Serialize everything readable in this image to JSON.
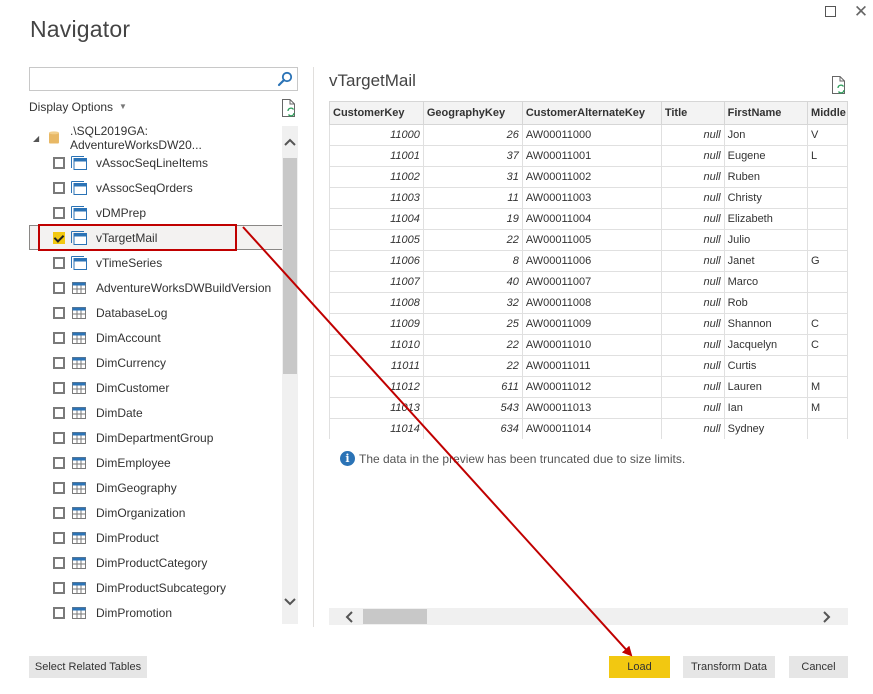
{
  "window": {
    "title": "Navigator",
    "maximize_icon": "maximize-icon",
    "close_icon": "close-icon",
    "close_glyph": "✕"
  },
  "left_panel": {
    "search": {
      "value": "",
      "placeholder": "",
      "icon": "search-icon"
    },
    "display_options": {
      "label": "Display Options",
      "caret": "▼"
    },
    "refresh_icon": "refresh-document-icon",
    "tree": {
      "root": {
        "label": ".\\SQL2019GA: AdventureWorksDW20...",
        "icon": "database-icon",
        "expander": "◢"
      },
      "items": [
        {
          "label": "vAssocSeqLineItems",
          "type": "view",
          "checked": false
        },
        {
          "label": "vAssocSeqOrders",
          "type": "view",
          "checked": false
        },
        {
          "label": "vDMPrep",
          "type": "view",
          "checked": false
        },
        {
          "label": "vTargetMail",
          "type": "view",
          "checked": true
        },
        {
          "label": "vTimeSeries",
          "type": "view",
          "checked": false
        },
        {
          "label": "AdventureWorksDWBuildVersion",
          "type": "table",
          "checked": false
        },
        {
          "label": "DatabaseLog",
          "type": "table",
          "checked": false
        },
        {
          "label": "DimAccount",
          "type": "table",
          "checked": false
        },
        {
          "label": "DimCurrency",
          "type": "table",
          "checked": false
        },
        {
          "label": "DimCustomer",
          "type": "table",
          "checked": false
        },
        {
          "label": "DimDate",
          "type": "table",
          "checked": false
        },
        {
          "label": "DimDepartmentGroup",
          "type": "table",
          "checked": false
        },
        {
          "label": "DimEmployee",
          "type": "table",
          "checked": false
        },
        {
          "label": "DimGeography",
          "type": "table",
          "checked": false
        },
        {
          "label": "DimOrganization",
          "type": "table",
          "checked": false
        },
        {
          "label": "DimProduct",
          "type": "table",
          "checked": false
        },
        {
          "label": "DimProductCategory",
          "type": "table",
          "checked": false
        },
        {
          "label": "DimProductSubcategory",
          "type": "table",
          "checked": false
        },
        {
          "label": "DimPromotion",
          "type": "table",
          "checked": false
        }
      ]
    },
    "scroll_up": "⌃",
    "scroll_down": "⌄"
  },
  "preview": {
    "title": "vTargetMail",
    "columns": [
      "CustomerKey",
      "GeographyKey",
      "CustomerAlternateKey",
      "Title",
      "FirstName",
      "Middle"
    ],
    "rows": [
      [
        "11000",
        "26",
        "AW00011000",
        "null",
        "Jon",
        "V"
      ],
      [
        "11001",
        "37",
        "AW00011001",
        "null",
        "Eugene",
        "L"
      ],
      [
        "11002",
        "31",
        "AW00011002",
        "null",
        "Ruben",
        ""
      ],
      [
        "11003",
        "11",
        "AW00011003",
        "null",
        "Christy",
        ""
      ],
      [
        "11004",
        "19",
        "AW00011004",
        "null",
        "Elizabeth",
        ""
      ],
      [
        "11005",
        "22",
        "AW00011005",
        "null",
        "Julio",
        ""
      ],
      [
        "11006",
        "8",
        "AW00011006",
        "null",
        "Janet",
        "G"
      ],
      [
        "11007",
        "40",
        "AW00011007",
        "null",
        "Marco",
        ""
      ],
      [
        "11008",
        "32",
        "AW00011008",
        "null",
        "Rob",
        ""
      ],
      [
        "11009",
        "25",
        "AW00011009",
        "null",
        "Shannon",
        "C"
      ],
      [
        "11010",
        "22",
        "AW00011010",
        "null",
        "Jacquelyn",
        "C"
      ],
      [
        "11011",
        "22",
        "AW00011011",
        "null",
        "Curtis",
        ""
      ],
      [
        "11012",
        "611",
        "AW00011012",
        "null",
        "Lauren",
        "M"
      ],
      [
        "11013",
        "543",
        "AW00011013",
        "null",
        "Ian",
        "M"
      ],
      [
        "11014",
        "634",
        "AW00011014",
        "null",
        "Sydney",
        ""
      ]
    ],
    "info_icon": "i",
    "info_message": "The data in the preview has been truncated due to size limits.",
    "scroll_left": "❮",
    "scroll_right": "❯"
  },
  "footer": {
    "select_related_label": "Select Related Tables",
    "load_label": "Load",
    "transform_label": "Transform Data",
    "cancel_label": "Cancel"
  },
  "colors": {
    "accent": "#f2c811",
    "annotation": "#c00000",
    "icon_blue": "#2b73b6"
  }
}
